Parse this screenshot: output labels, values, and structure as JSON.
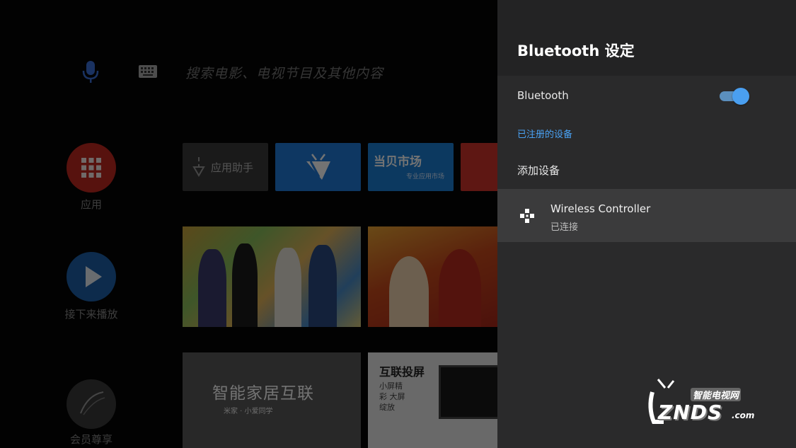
{
  "home": {
    "search_hint": "搜索电影、电视节目及其他内容",
    "rail": [
      {
        "label": "应用"
      },
      {
        "label": "接下来播放"
      },
      {
        "label": "会员尊享"
      }
    ],
    "app_tiles": [
      {
        "label": "应用助手"
      },
      {
        "label": ""
      },
      {
        "label": "当贝市场",
        "sub": "专业应用市场"
      },
      {
        "label": ""
      }
    ],
    "posters": [
      {
        "title": "",
        "sub": ""
      },
      {
        "title": "",
        "sub": ""
      },
      {
        "title": "智能家居互联",
        "sub": "米家 · 小爱同学"
      },
      {
        "title": "互联投屏",
        "sub": "小屏精彩 大屏绽放"
      }
    ]
  },
  "panel": {
    "title": "Bluetooth 设定",
    "bluetooth_label": "Bluetooth",
    "bluetooth_on": true,
    "section_registered": "已注册的设备",
    "add_device": "添加设备",
    "devices": [
      {
        "name": "Wireless Controller",
        "status": "已连接",
        "icon": "gamepad-icon"
      }
    ]
  },
  "watermark": {
    "cn": "智能电视网",
    "brand": "ZNDS",
    "domain": ".com"
  },
  "colors": {
    "accent": "#4a9ff0",
    "panel_bg": "#2a2a2b",
    "selected_row": "#3b3b3c"
  }
}
